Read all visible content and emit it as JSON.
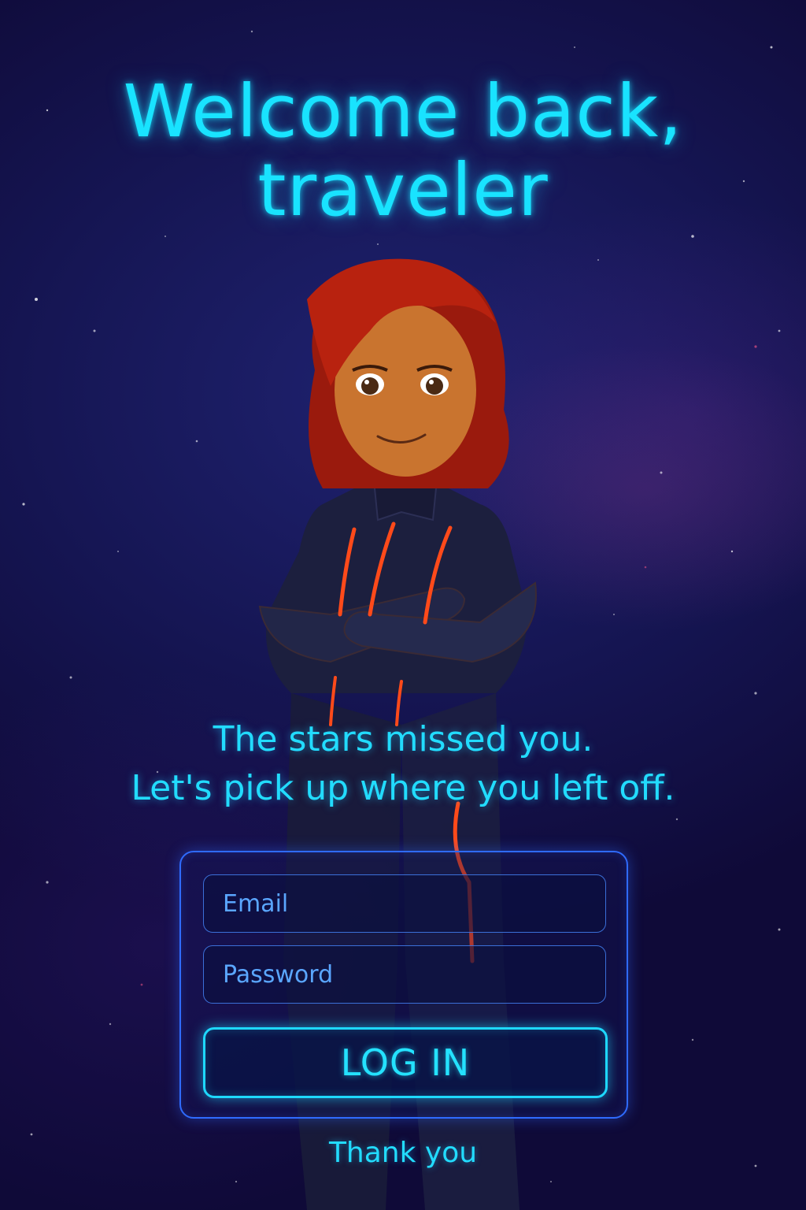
{
  "header": {
    "title_line1": "Welcome back,",
    "title_line2": "traveler"
  },
  "tagline": {
    "line1": "The stars missed you.",
    "line2": "Let's pick up where you left off."
  },
  "login_form": {
    "email_placeholder": "Email",
    "password_placeholder": "Password",
    "login_label": "LOG IN"
  },
  "footer": {
    "thank_you": "Thank you"
  },
  "colors": {
    "background": "#151552",
    "accent_cyan": "#19e3ff",
    "card_border": "#2f6bff",
    "suit_glow": "#ff4a1a",
    "hair": "#b8220f"
  }
}
